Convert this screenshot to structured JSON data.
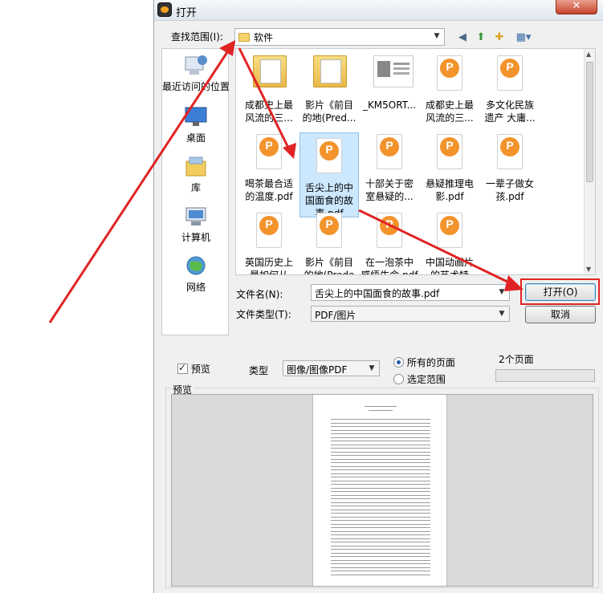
{
  "window": {
    "title": "打开",
    "close": "✕"
  },
  "lookin": {
    "label": "查找范围(I):",
    "value": "软件"
  },
  "places": [
    {
      "label": "最近访问的位置",
      "icon": "recent-places-icon"
    },
    {
      "label": "桌面",
      "icon": "desktop-icon"
    },
    {
      "label": "库",
      "icon": "libraries-icon"
    },
    {
      "label": "计算机",
      "icon": "computer-icon"
    },
    {
      "label": "网络",
      "icon": "network-icon"
    }
  ],
  "files": [
    {
      "line1": "成都史上最",
      "line2": "风流的三...",
      "type": "folder"
    },
    {
      "line1": "影片《前目",
      "line2": "的地(Pred...",
      "type": "folder"
    },
    {
      "line1": "_KM5ORT...",
      "line2": "",
      "type": "image"
    },
    {
      "line1": "成都史上最",
      "line2": "风流的三...",
      "type": "pdf"
    },
    {
      "line1": "多文化民族",
      "line2": "遗产 大庸...",
      "type": "pdf"
    },
    {
      "line1": "喝茶最合适",
      "line2": "的温度.pdf",
      "type": "pdf"
    },
    {
      "line1": "舌尖上的中",
      "line2": "国面食的故",
      "line3": "事.pdf",
      "type": "pdf",
      "selected": true
    },
    {
      "line1": "十部关于密",
      "line2": "室悬疑的...",
      "type": "pdf"
    },
    {
      "line1": "悬疑推理电",
      "line2": "影.pdf",
      "type": "pdf"
    },
    {
      "line1": "一辈子做女",
      "line2": "孩.pdf",
      "type": "pdf"
    },
    {
      "line1": "英国历史上",
      "line2": "最如何从",
      "type": "pdf"
    },
    {
      "line1": "影片《前目",
      "line2": "的地(Prede",
      "type": "pdf"
    },
    {
      "line1": "在一泡茶中",
      "line2": "感悟生命.pdf",
      "type": "pdf"
    },
    {
      "line1": "中国动画片",
      "line2": "的艺术特",
      "type": "pdf"
    }
  ],
  "filename": {
    "label": "文件名(N):",
    "value": "舌尖上的中国面食的故事.pdf"
  },
  "filetype": {
    "label": "文件类型(T):",
    "value": "PDF/图片"
  },
  "buttons": {
    "open": "打开(O)",
    "cancel": "取消"
  },
  "options": {
    "preview_checkbox": "预览",
    "type_label": "类型",
    "type_value": "图像/图像PDF",
    "all_pages": "所有的页面",
    "select_range": "选定范围",
    "page_count": "2个页面"
  },
  "preview": {
    "label": "预览"
  },
  "colors": {
    "annotation": "#e02424",
    "selection": "#cce8ff",
    "pdf_icon": "#f2932c"
  }
}
